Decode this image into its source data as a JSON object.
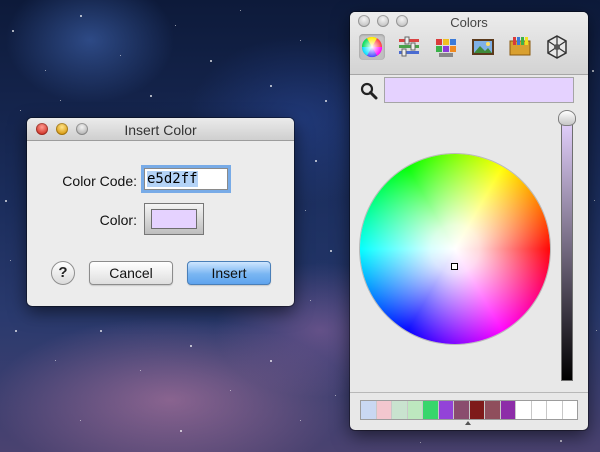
{
  "insert_dialog": {
    "title": "Insert Color",
    "color_code_label": "Color Code:",
    "color_code_value": "e5d2ff",
    "color_label": "Color:",
    "color_swatch": "#e5d2ff",
    "help_label": "?",
    "cancel_label": "Cancel",
    "insert_label": "Insert"
  },
  "colors_panel": {
    "title": "Colors",
    "tools": [
      "color-wheel-icon",
      "color-sliders-icon",
      "color-palettes-icon",
      "image-palettes-icon",
      "crayons-icon",
      "spectrum-icon"
    ],
    "active_tool": "color-wheel-icon",
    "selected_color": "#e5d2ff",
    "brightness": 1.0,
    "swatches": [
      "#c9d8f2",
      "#f3c7cf",
      "#c9e3cf",
      "#bde8bf",
      "#38d66b",
      "#9343d8",
      "#8a4c6e",
      "#7e1a19",
      "#8f4e5c",
      "#8d2da8",
      "#ffffff",
      "#ffffff",
      "#ffffff",
      "#ffffff"
    ]
  },
  "colors": {
    "accent_blue": "#6aaef0",
    "window_bg": "#ececec"
  }
}
